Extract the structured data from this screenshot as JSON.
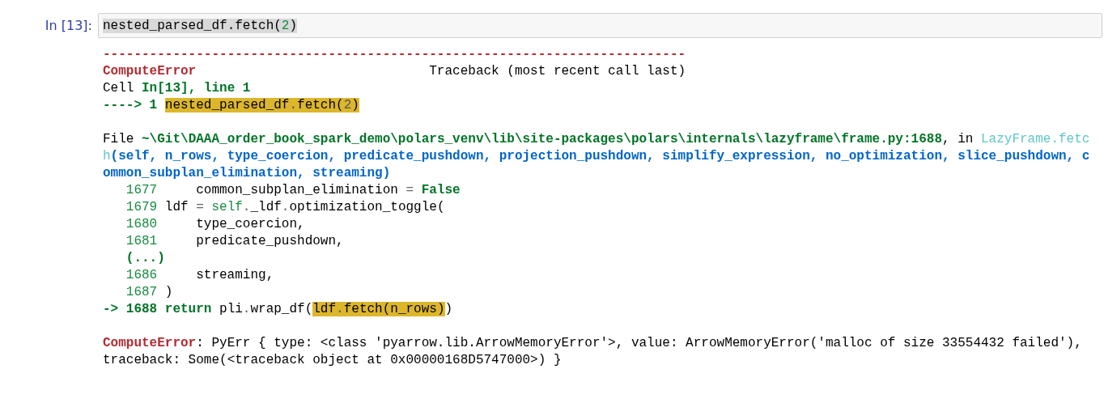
{
  "cell": {
    "prompt": "In [13]:",
    "input": [
      {
        "text": "nested_parsed_df.fetch(",
        "kind": "plain"
      },
      {
        "text": "2",
        "kind": "num"
      },
      {
        "text": ")",
        "kind": "plain"
      }
    ]
  },
  "output": [
    [
      {
        "kind": "text",
        "segments": [
          {
            "text": "---------------------------------------------------------------------------",
            "kind": "exc"
          }
        ]
      },
      {
        "kind": "text",
        "segments": [
          {
            "text": "ComputeError",
            "kind": "exc"
          },
          {
            "text": "                              Traceback (most recent call last)",
            "kind": "plain"
          }
        ]
      },
      {
        "kind": "text",
        "segments": [
          {
            "text": "Cell ",
            "kind": "plain"
          },
          {
            "text": "In[13], line 1",
            "kind": "strong"
          }
        ]
      },
      {
        "kind": "text",
        "segments": [
          {
            "text": "----> 1 ",
            "kind": "strong"
          },
          {
            "text": "nested_parsed_df",
            "kind": "mark"
          },
          {
            "text": ".",
            "kind": "markop"
          },
          {
            "text": "fetch(",
            "kind": "mark"
          },
          {
            "text": "2",
            "kind": "markop"
          },
          {
            "text": ")",
            "kind": "mark"
          }
        ]
      }
    ],
    [
      {
        "kind": "text",
        "segments": [
          {
            "text": "File ",
            "kind": "plain"
          },
          {
            "text": "~\\Git\\DAAA_order_book_spark_demo\\polars_venv\\lib\\site-packages\\polars\\internals\\lazyframe\\frame.py:1688",
            "kind": "strong"
          },
          {
            "text": ", in ",
            "kind": "plain"
          },
          {
            "text": "LazyFrame.fetc",
            "kind": "cyan"
          }
        ]
      },
      {
        "kind": "text",
        "segments": [
          {
            "text": "h",
            "kind": "cyan"
          },
          {
            "text": "(self, n_rows, type_coercion, predicate_pushdown, projection_pushdown, simplify_expression, no_optimization, slice_pushdown, c",
            "kind": "blue"
          }
        ]
      },
      {
        "kind": "text",
        "segments": [
          {
            "text": "ommon_subplan_elimination, streaming)",
            "kind": "blue"
          }
        ]
      },
      {
        "kind": "src",
        "number": "1677",
        "segments": [
          {
            "text": "     common_subplan_elimination ",
            "kind": "plain"
          },
          {
            "text": "= ",
            "kind": "op"
          },
          {
            "text": "False",
            "kind": "strong"
          }
        ]
      },
      {
        "kind": "src",
        "number": "1679",
        "segments": [
          {
            "text": " ldf ",
            "kind": "plain"
          },
          {
            "text": "= ",
            "kind": "op"
          },
          {
            "text": "self",
            "kind": "num"
          },
          {
            "text": ".",
            "kind": "op"
          },
          {
            "text": "_ldf",
            "kind": "plain"
          },
          {
            "text": ".",
            "kind": "op"
          },
          {
            "text": "optimization_toggle(",
            "kind": "plain"
          }
        ]
      },
      {
        "kind": "src",
        "number": "1680",
        "segments": [
          {
            "text": "     type_coercion,",
            "kind": "plain"
          }
        ]
      },
      {
        "kind": "src",
        "number": "1681",
        "segments": [
          {
            "text": "     predicate_pushdown,",
            "kind": "plain"
          }
        ]
      },
      {
        "kind": "src",
        "segments": [
          {
            "text": "(...)",
            "kind": "strong"
          }
        ]
      },
      {
        "kind": "src",
        "number": "1686",
        "segments": [
          {
            "text": "     streaming,",
            "kind": "plain"
          }
        ]
      },
      {
        "kind": "src",
        "number": "1687",
        "segments": [
          {
            "text": " )",
            "kind": "plain"
          }
        ]
      },
      {
        "kind": "text",
        "segments": [
          {
            "text": "-> 1688 return",
            "kind": "strong"
          },
          {
            "text": " pli",
            "kind": "plain"
          },
          {
            "text": ".",
            "kind": "op"
          },
          {
            "text": "wrap_df(",
            "kind": "plain"
          },
          {
            "text": "ldf",
            "kind": "mark"
          },
          {
            "text": ".",
            "kind": "markop"
          },
          {
            "text": "fetch(n_rows)",
            "kind": "mark"
          },
          {
            "text": ")",
            "kind": "plain"
          }
        ]
      }
    ],
    [
      {
        "kind": "text",
        "segments": [
          {
            "text": "ComputeError",
            "kind": "exc"
          },
          {
            "text": ": PyErr { type: <class 'pyarrow.lib.ArrowMemoryError'>, value: ArrowMemoryError('malloc of size 33554432 failed'),",
            "kind": "plain"
          }
        ]
      },
      {
        "kind": "text",
        "segments": [
          {
            "text": "traceback: Some(<traceback object at 0x00000168D5747000>) }",
            "kind": "plain"
          }
        ]
      }
    ]
  ]
}
